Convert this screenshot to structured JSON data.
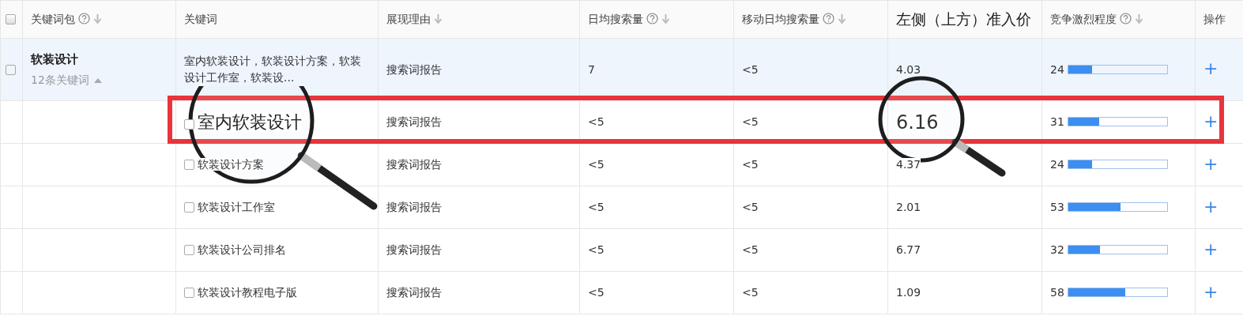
{
  "columns": [
    {
      "label": "关键词包",
      "help": true,
      "sortable": true
    },
    {
      "label": "关键词",
      "help": false,
      "sortable": false
    },
    {
      "label": "展现理由",
      "help": false,
      "sortable": true
    },
    {
      "label": "日均搜索量",
      "help": true,
      "sortable": true
    },
    {
      "label": "移动日均搜索量",
      "help": true,
      "sortable": true
    },
    {
      "label": "左侧（上方）准入价",
      "help": false,
      "sortable": false
    },
    {
      "label": "竞争激烈程度",
      "help": true,
      "sortable": true
    },
    {
      "label": "操作",
      "help": false,
      "sortable": false
    }
  ],
  "select_all": {
    "checked": false
  },
  "group": {
    "name": "软装设计",
    "count": "12条关键词",
    "expanded": true,
    "checked": false,
    "keywords": "室内软装设计，软装设计方案，软装设计工作室，软装设...",
    "reason": "搜索词报告",
    "daily": "7",
    "mobile": "<5",
    "price": "4.03",
    "competition": "24",
    "level": 0.24,
    "action": "+"
  },
  "rows": [
    {
      "keyword": "室内软装设计",
      "checked": false,
      "highlighted": true,
      "reason": "搜索词报告",
      "daily": "<5",
      "mobile": "<5",
      "price": "6.16",
      "competition": "31",
      "level": 0.31,
      "action": "+"
    },
    {
      "keyword": "软装设计方案",
      "checked": false,
      "highlighted": false,
      "reason": "搜索词报告",
      "daily": "<5",
      "mobile": "<5",
      "price": "4.37",
      "competition": "24",
      "level": 0.24,
      "action": "+"
    },
    {
      "keyword": "软装设计工作室",
      "checked": false,
      "highlighted": false,
      "reason": "搜索词报告",
      "daily": "<5",
      "mobile": "<5",
      "price": "2.01",
      "competition": "53",
      "level": 0.53,
      "action": "+"
    },
    {
      "keyword": "软装设计公司排名",
      "checked": false,
      "highlighted": false,
      "reason": "搜索词报告",
      "daily": "<5",
      "mobile": "<5",
      "price": "6.77",
      "competition": "32",
      "level": 0.32,
      "action": "+"
    },
    {
      "keyword": "软装设计教程电子版",
      "checked": false,
      "highlighted": false,
      "reason": "搜索词报告",
      "daily": "<5",
      "mobile": "<5",
      "price": "1.09",
      "competition": "58",
      "level": 0.58,
      "action": "+"
    }
  ]
}
